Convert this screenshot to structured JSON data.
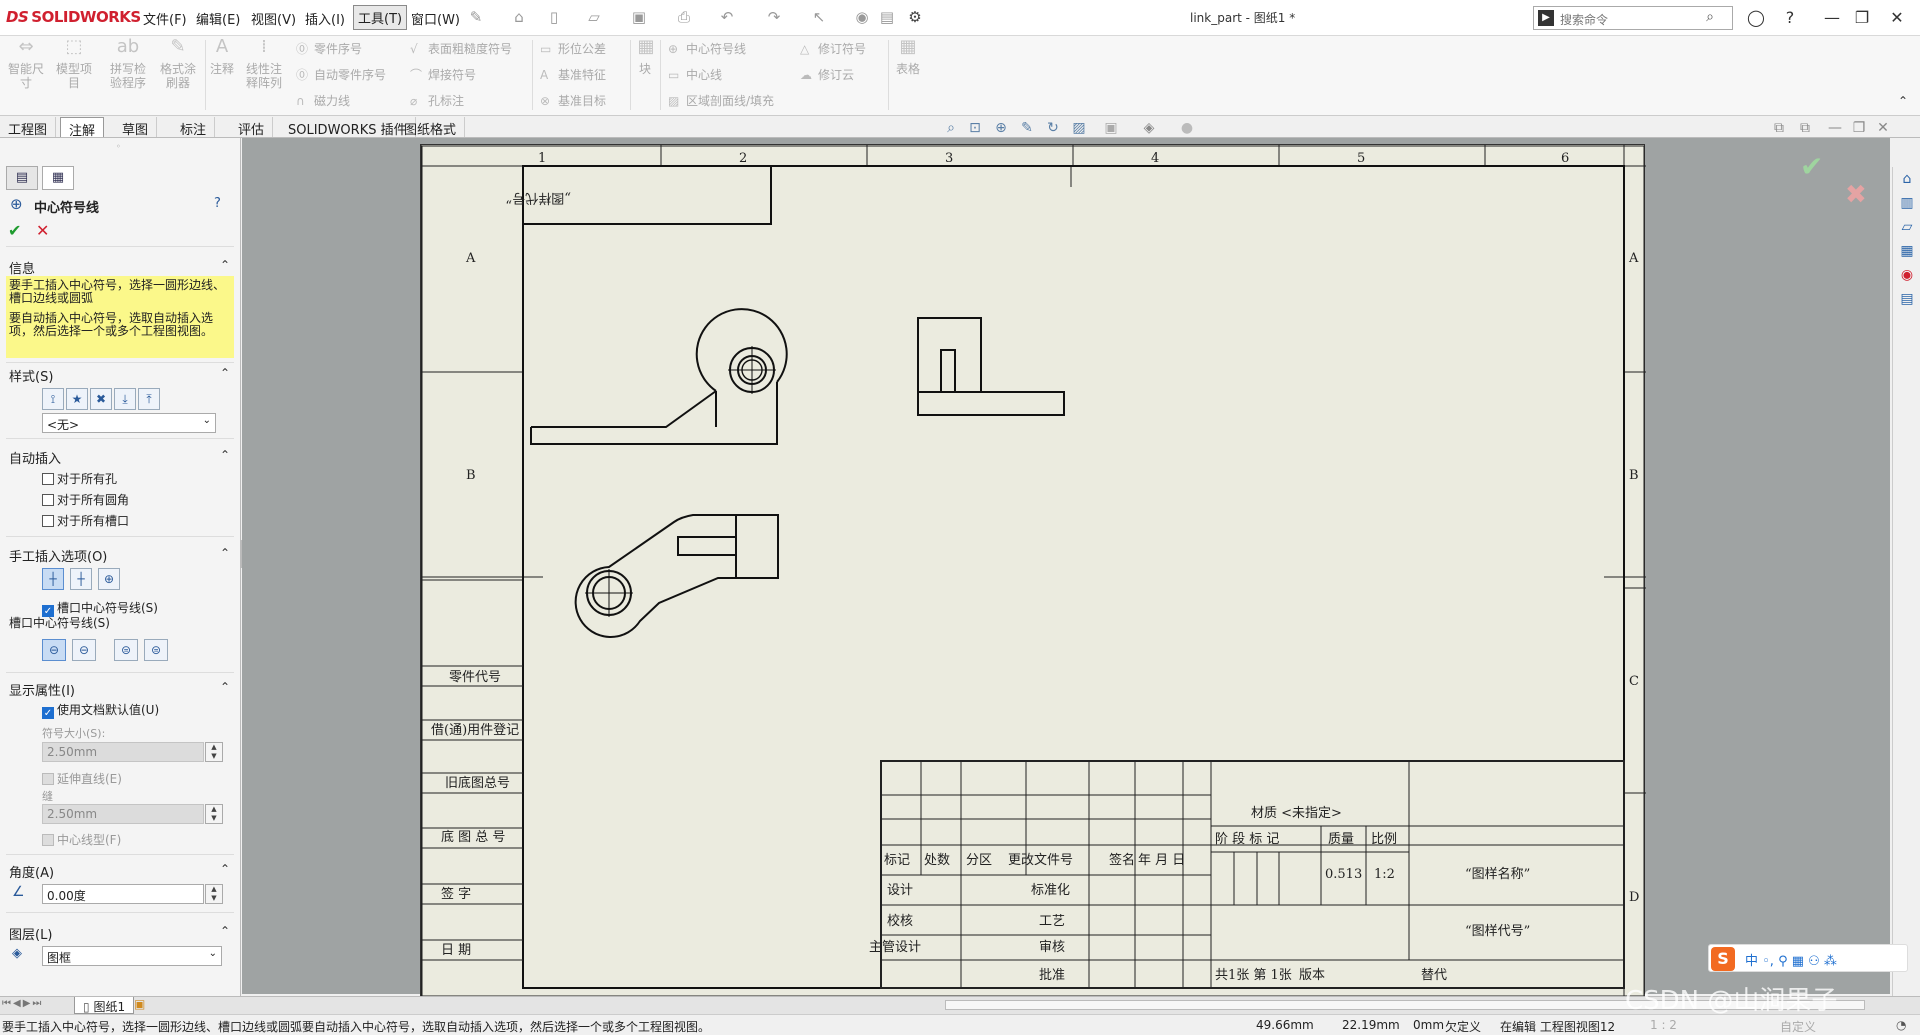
{
  "app": {
    "logo": "SOLIDWORKS",
    "logo_mark": "DS",
    "document_title": "link_part - 图纸1 *"
  },
  "menu": [
    "文件(F)",
    "编辑(E)",
    "视图(V)",
    "插入(I)",
    "工具(T)",
    "窗口(W)"
  ],
  "search": {
    "placeholder": "搜索命令"
  },
  "ribbon": {
    "big": [
      {
        "label": "智能尺寸"
      },
      {
        "label": "模型项目"
      },
      {
        "label": "拼写检验程序"
      },
      {
        "label": "格式涂刷器"
      },
      {
        "label": "注释"
      },
      {
        "label": "线性注释阵列"
      }
    ],
    "col1": [
      "零件序号",
      "自动零件序号",
      "磁力线"
    ],
    "col2": [
      "表面粗糙度符号",
      "焊接符号",
      "孔标注"
    ],
    "col3": [
      "形位公差",
      "基准特征",
      "基准目标"
    ],
    "block": "块",
    "col4": [
      "中心符号线",
      "中心线",
      "区域剖面线/填充"
    ],
    "col5": [
      "修订符号",
      "修订云"
    ],
    "table": "表格"
  },
  "tabs": [
    "工程图",
    "注解",
    "草图",
    "标注",
    "评估",
    "SOLIDWORKS 插件",
    "图纸格式"
  ],
  "active_tab": "注解",
  "panel": {
    "title": "中心符号线",
    "info_header": "信息",
    "info_text_1": "要手工插入中心符号，选择一圆形边线、槽口边线或圆弧",
    "info_text_2": "要自动插入中心符号，选取自动插入选项，然后选择一个或多个工程图视图。",
    "style_header": "样式(S)",
    "style_value": "<无>",
    "auto_header": "自动插入",
    "auto_items": [
      "对于所有孔",
      "对于所有圆角",
      "对于所有槽口"
    ],
    "manual_header": "手工插入选项(O)",
    "slot_cb": "槽口中心符号线(S)",
    "slot_label": "槽口中心符号线(S)",
    "display_header": "显示属性(I)",
    "use_default": "使用文档默认值(U)",
    "mark_size_label": "符号大小(S):",
    "mark_size": "2.50mm",
    "extend_label": "延伸直线(E)",
    "gap_label": "缝",
    "gap_value": "2.50mm",
    "centerline_label": "中心线型(F)",
    "angle_header": "角度(A)",
    "angle_value": "0.00度",
    "layer_header": "图层(L)",
    "layer_value": "图框"
  },
  "drawing": {
    "zones_top": [
      "1",
      "2",
      "3",
      "4",
      "5",
      "6"
    ],
    "zones_side": [
      "A",
      "B",
      "C",
      "D"
    ],
    "code_box": "„图样代号”",
    "left_labels": [
      "零件代号",
      "借(通)用件登记",
      "旧底图总号",
      "底 图 总 号",
      "签    字",
      "日    期"
    ],
    "tb_headers": [
      "标记",
      "处数",
      "分区",
      "更改文件号",
      "签名",
      "年 月 日"
    ],
    "tb_rows": [
      "设计",
      "标准化",
      "校核",
      "工艺",
      "主管设计",
      "审核",
      "批准"
    ],
    "material": "材质 <未指定>",
    "stage_label": "阶 段 标 记",
    "mass_label": "质量",
    "scale_label": "比例",
    "mass": "0.513",
    "scale": "1:2",
    "drawing_name": "“图样名称”",
    "drawing_code": "“图样代号”",
    "sheets": "共1张 第 1张",
    "version": "版本",
    "replace": "替代"
  },
  "sheet_tab": "图纸1",
  "status": {
    "message": "要手工插入中心符号，选择一圆形边线、槽口边线或圆弧要自动插入中心符号，选取自动插入选项，然后选择一个或多个工程图视图。",
    "x": "49.66mm",
    "y": "22.19mm",
    "z": "0mm",
    "state": "欠定义",
    "mode": "在编辑 工程图视图12",
    "scale": "1 : 2",
    "custom": "自定义"
  },
  "watermark": "CSDN @山涧果子",
  "ime": "中 ◦, ⚲ ▦ ⚇ ⁂"
}
